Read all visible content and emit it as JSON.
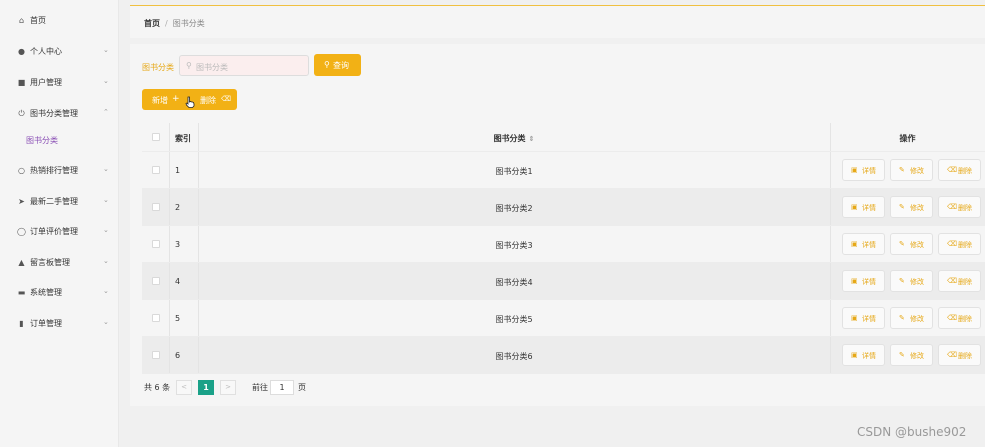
{
  "sidebar": {
    "items": [
      {
        "label": "首页",
        "icon": "home-icon",
        "has_children": false
      },
      {
        "label": "个人中心",
        "icon": "user-icon",
        "has_children": true
      },
      {
        "label": "用户管理",
        "icon": "briefcase-icon",
        "has_children": true
      },
      {
        "label": "图书分类管理",
        "icon": "power-icon",
        "has_children": true,
        "expanded": true
      },
      {
        "label": "热销排行管理",
        "icon": "bulb-icon",
        "has_children": true
      },
      {
        "label": "最新二手管理",
        "icon": "send-icon",
        "has_children": true
      },
      {
        "label": "订单评价管理",
        "icon": "globe-icon",
        "has_children": true
      },
      {
        "label": "留言板管理",
        "icon": "person-pin-icon",
        "has_children": true
      },
      {
        "label": "系统管理",
        "icon": "print-icon",
        "has_children": true
      },
      {
        "label": "订单管理",
        "icon": "chart-icon",
        "has_children": true
      }
    ],
    "sub_item": {
      "label": "图书分类"
    }
  },
  "breadcrumb": {
    "home": "首页",
    "separator": "/",
    "current": "图书分类"
  },
  "search": {
    "label": "图书分类",
    "placeholder": "图书分类",
    "query_label": "查询"
  },
  "actions": {
    "add_label": "新增",
    "delete_label": "删除"
  },
  "table": {
    "headers": {
      "index": "索引",
      "name": "图书分类",
      "ops": "操作"
    },
    "rows": [
      {
        "index": "1",
        "name": "图书分类1"
      },
      {
        "index": "2",
        "name": "图书分类2"
      },
      {
        "index": "3",
        "name": "图书分类3"
      },
      {
        "index": "4",
        "name": "图书分类4"
      },
      {
        "index": "5",
        "name": "图书分类5"
      },
      {
        "index": "6",
        "name": "图书分类6"
      }
    ],
    "row_actions": {
      "detail": "详情",
      "edit": "修改",
      "delete": "删除"
    }
  },
  "pagination": {
    "total_text": "共 6 条",
    "current_page": "1",
    "goto_label": "前往",
    "goto_value": "1",
    "page_unit": "页"
  },
  "watermark": "CSDN @bushe902",
  "colors": {
    "accent": "#f2b115",
    "active_page": "#1aa188",
    "sub_active": "#8a4fb5"
  }
}
